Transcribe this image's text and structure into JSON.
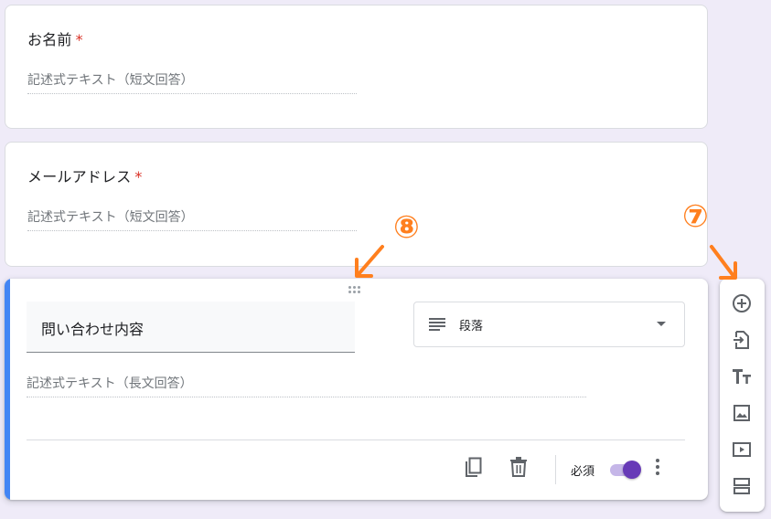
{
  "questions": [
    {
      "title": "お名前",
      "required_mark": "*",
      "answer_placeholder": "記述式テキスト（短文回答）"
    },
    {
      "title": "メールアドレス",
      "required_mark": "*",
      "answer_placeholder": "記述式テキスト（短文回答）"
    }
  ],
  "active_question": {
    "title": "問い合わせ内容",
    "type_icon": "paragraph-lines-icon",
    "type_label": "段落",
    "answer_placeholder": "記述式テキスト（長文回答）",
    "required_label": "必須",
    "required_on": true
  },
  "side_toolbar": [
    {
      "icon": "add-question-icon"
    },
    {
      "icon": "import-questions-icon"
    },
    {
      "icon": "add-title-description-icon"
    },
    {
      "icon": "add-image-icon"
    },
    {
      "icon": "add-video-icon"
    },
    {
      "icon": "add-section-icon"
    }
  ],
  "annotations": {
    "marker_7": "⑦",
    "marker_8": "⑧"
  },
  "colors": {
    "background": "#efebf8",
    "accent_bar": "#4285f4",
    "toggle": "#673ab7",
    "required_star": "#d93025",
    "annotation": "#ff7f1e"
  }
}
